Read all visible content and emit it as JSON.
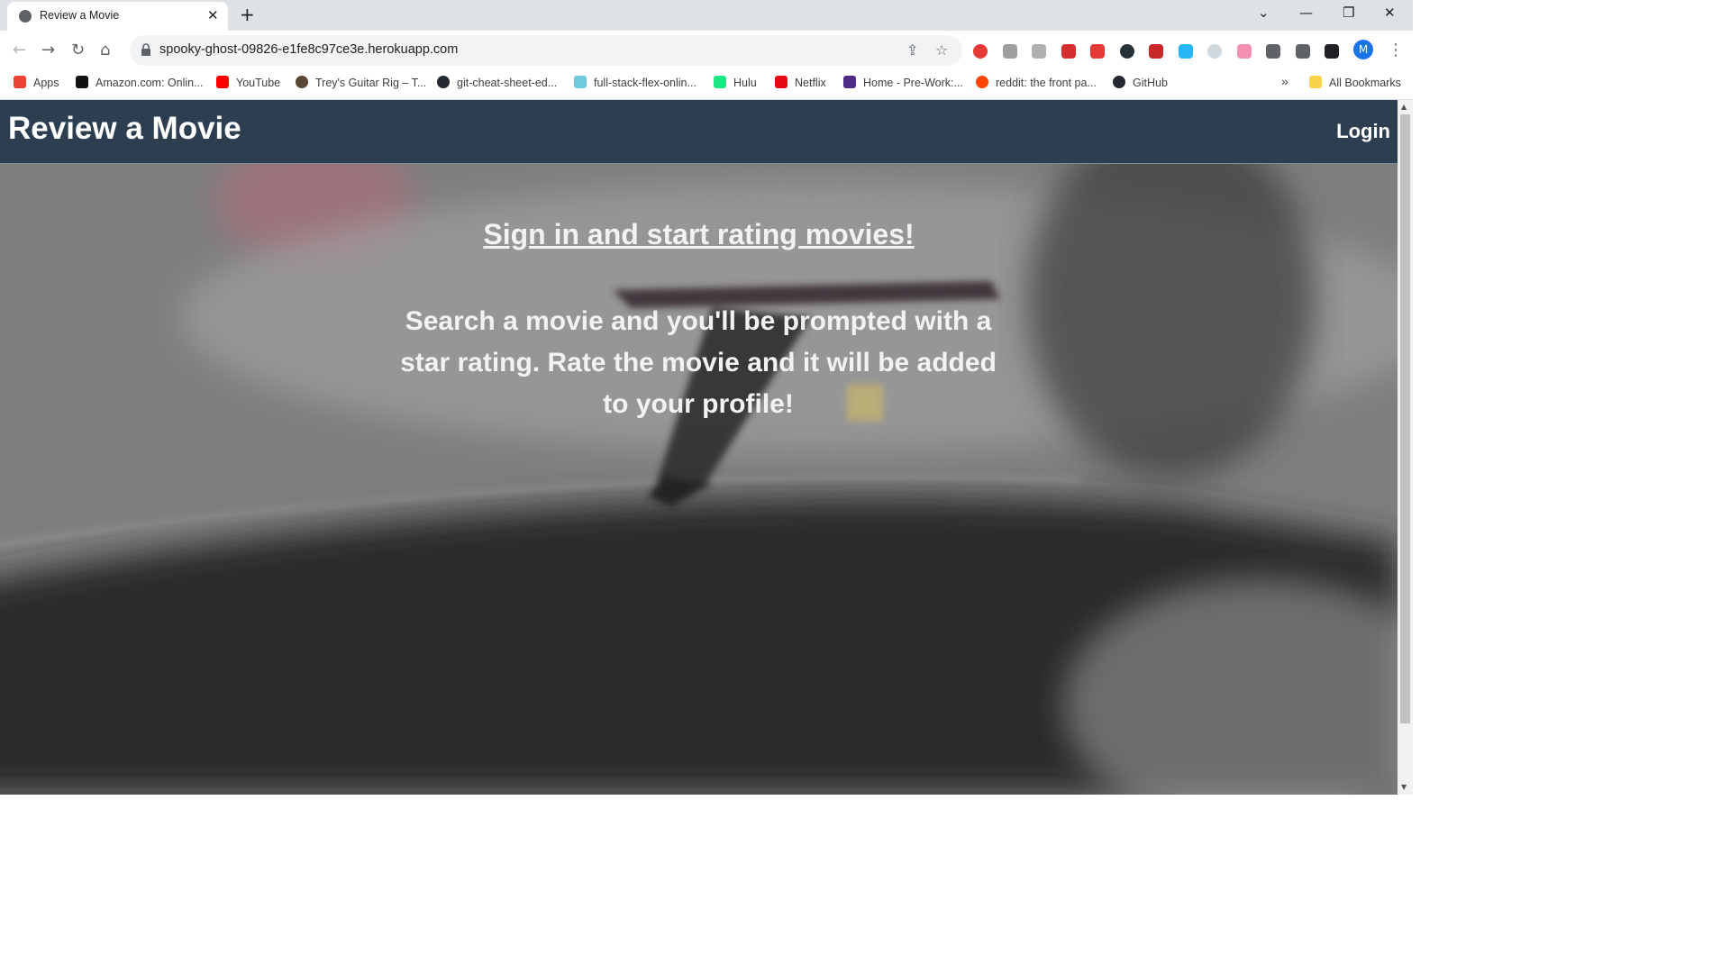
{
  "browser": {
    "tab_title": "Review a Movie",
    "tab_close": "✕",
    "new_tab": "+",
    "url": "spooky-ghost-09826-e1fe8c97ce3e.herokuapp.com",
    "profile_initial": "M",
    "window_controls": [
      "⌄",
      "—",
      "❐",
      "✕"
    ],
    "nav": {
      "back": "←",
      "forward": "→",
      "reload": "↻",
      "home": "⌂"
    },
    "bookmarks": [
      {
        "label": "Apps",
        "color": "#ea4335"
      },
      {
        "label": "Amazon.com: Onlin...",
        "color": "#111111"
      },
      {
        "label": "YouTube",
        "color": "#ff0000"
      },
      {
        "label": "Trey's Guitar Rig – T...",
        "color": "#5a4634"
      },
      {
        "label": "git-cheat-sheet-ed...",
        "color": "#24292f"
      },
      {
        "label": "full-stack-flex-onlin...",
        "color": "#6ecadc"
      },
      {
        "label": "Hulu",
        "color": "#1ce783"
      },
      {
        "label": "Netflix",
        "color": "#e50914"
      },
      {
        "label": "Home - Pre-Work:...",
        "color": "#4e2a84"
      },
      {
        "label": "reddit: the front pa...",
        "color": "#ff4500"
      },
      {
        "label": "GitHub",
        "color": "#24292f"
      }
    ],
    "bookmarks_overflow": "»",
    "all_bookmarks": "All Bookmarks"
  },
  "site": {
    "title": "Review a Movie",
    "login": "Login",
    "cta": "Sign in and start rating movies!",
    "description": "Search a movie and you'll be prompted with a star rating. Rate the movie and it will be added to your profile!"
  },
  "colors": {
    "header_bg": "#2c3e50",
    "accent": "#1a73e8"
  }
}
